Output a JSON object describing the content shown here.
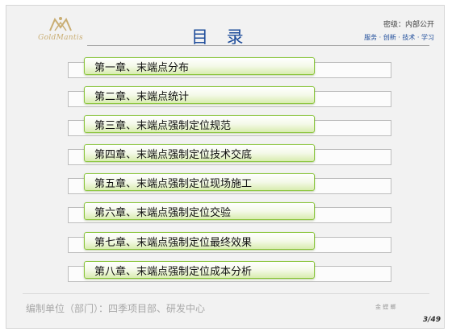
{
  "header": {
    "logo_text": "GoldMantis",
    "title": "目  录",
    "confidential": "密级：内部公开",
    "slogan": "服务 · 创新 · 技术 · 学习"
  },
  "toc": {
    "items": [
      {
        "label": "第一章、末端点分布"
      },
      {
        "label": "第二章、末端点统计"
      },
      {
        "label": "第三章、末端点强制定位规范"
      },
      {
        "label": "第四章、末端点强制定位技术交底"
      },
      {
        "label": "第五章、末端点强制定位现场施工"
      },
      {
        "label": "第六章、末端点强制定位交验"
      },
      {
        "label": "第七章、末端点强制定位最终效果"
      },
      {
        "label": "第八章、末端点强制定位成本分析"
      }
    ]
  },
  "footer": {
    "org": "编制单位（部门）：四季项目部、研发中心",
    "brand": "金 螳 螂",
    "page": "3/49"
  },
  "colors": {
    "title": "#1f4d9b",
    "pill_border": "#8cc63f",
    "logo": "#c9ad72"
  }
}
